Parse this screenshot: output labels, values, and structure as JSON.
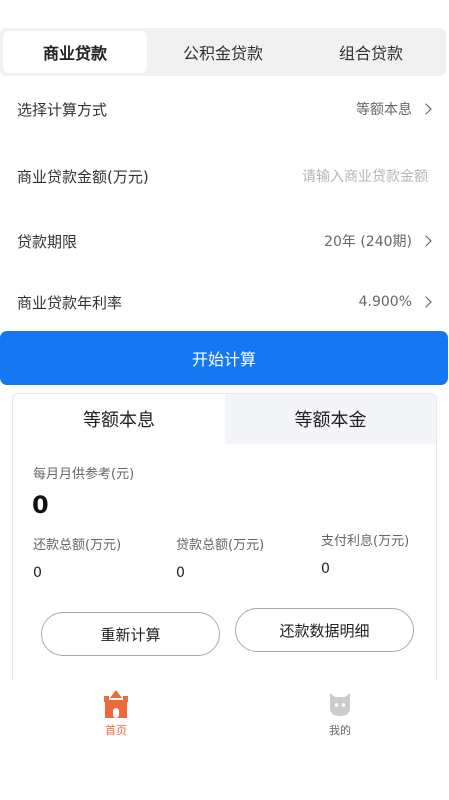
{
  "tabs": [
    {
      "label": "商业贷款"
    },
    {
      "label": "公积金贷款"
    },
    {
      "label": "组合贷款"
    }
  ],
  "form": {
    "method": {
      "label": "选择计算方式",
      "value": "等额本息"
    },
    "amount": {
      "label": "商业贷款金额(万元)",
      "placeholder": "请输入商业贷款金额"
    },
    "term": {
      "label": "贷款期限",
      "value": "20年 (240期)"
    },
    "rate": {
      "label": "商业贷款年利率",
      "value": "4.900%"
    }
  },
  "calc_button": "开始计算",
  "result": {
    "tabs": [
      {
        "label": "等额本息"
      },
      {
        "label": "等额本金"
      }
    ],
    "monthly_label": "每月月供参考(元)",
    "monthly_value": "0",
    "stats": [
      {
        "label": "还款总额(万元)",
        "value": "0"
      },
      {
        "label": "贷款总额(万元)",
        "value": "0"
      },
      {
        "label": "支付利息(万元)",
        "value": "0"
      }
    ],
    "recalc_button": "重新计算",
    "detail_button": "还款数据明细"
  },
  "nav": [
    {
      "label": "首页",
      "icon": "castle-icon",
      "color": "#ef6a3a"
    },
    {
      "label": "我的",
      "icon": "profile-icon",
      "color": "#cccccc"
    }
  ],
  "colors": {
    "accent": "#1478f2",
    "nav_active": "#ef6a3a"
  }
}
